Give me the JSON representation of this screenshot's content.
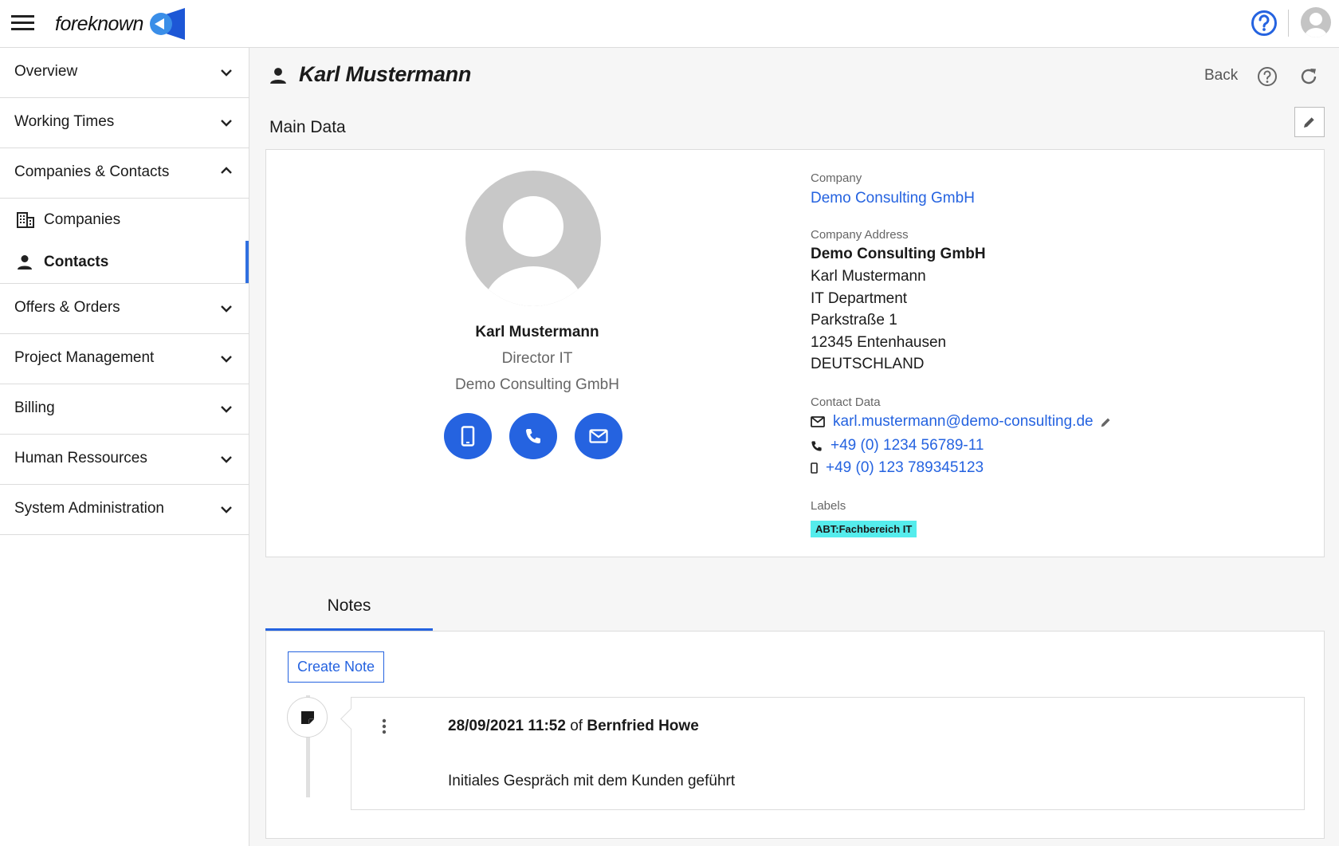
{
  "app": {
    "logo_text": "foreknown"
  },
  "sidebar": {
    "items": [
      {
        "label": "Overview"
      },
      {
        "label": "Working Times"
      },
      {
        "label": "Companies & Contacts"
      },
      {
        "label": "Offers & Orders"
      },
      {
        "label": "Project Management"
      },
      {
        "label": "Billing"
      },
      {
        "label": "Human Ressources"
      },
      {
        "label": "System Administration"
      }
    ],
    "sub_items": [
      {
        "label": "Companies"
      },
      {
        "label": "Contacts"
      }
    ]
  },
  "page": {
    "title": "Karl Mustermann",
    "back_label": "Back",
    "section_title": "Main Data"
  },
  "profile": {
    "name": "Karl Mustermann",
    "role": "Director IT",
    "company": "Demo Consulting GmbH"
  },
  "details": {
    "company_label": "Company",
    "company": "Demo Consulting GmbH",
    "address_label": "Company Address",
    "address_lines": [
      "Demo Consulting GmbH",
      "Karl Mustermann",
      "IT Department",
      "Parkstraße 1",
      "12345 Entenhausen",
      "DEUTSCHLAND"
    ],
    "contact_label": "Contact Data",
    "email": "karl.mustermann@demo-consulting.de",
    "phone": "+49 (0) 1234 56789-11",
    "mobile": "+49 (0) 123 789345123",
    "labels_label": "Labels",
    "tag": "ABT:Fachbereich IT",
    "tag_color": "#55ecec"
  },
  "notes": {
    "tab_label": "Notes",
    "create_label": "Create Note",
    "entry": {
      "datetime": "28/09/2021 11:52",
      "of": "of",
      "author": "Bernfried Howe",
      "text": "Initiales Gespräch mit dem Kunden geführt"
    }
  },
  "colors": {
    "accent": "#2563e0",
    "active_bar": "#2f6fe0"
  }
}
